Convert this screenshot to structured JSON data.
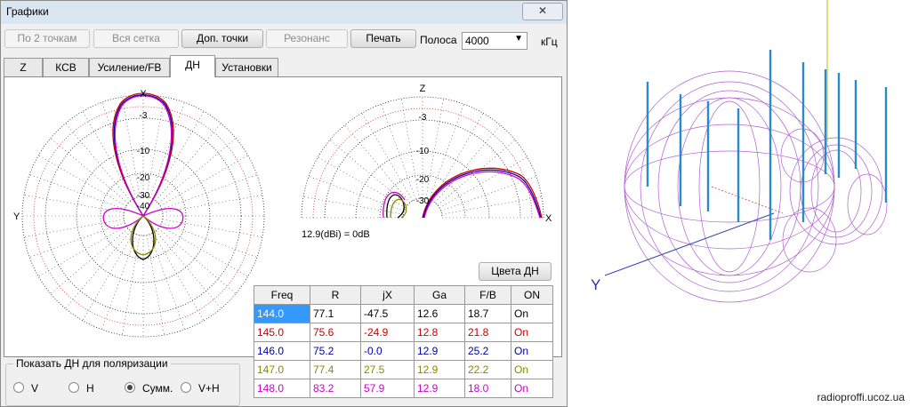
{
  "window": {
    "title": "Графики",
    "close_label": "✕"
  },
  "toolbar": {
    "btn1": "По 2 точкам",
    "btn2": "Вся сетка",
    "btn3": "Доп. точки",
    "btn4": "Резонанс",
    "btn5": "Печать",
    "band_label": "Полоса",
    "band_value": "4000",
    "band_unit": "кГц"
  },
  "tabs": [
    "Z",
    "КСВ",
    "Усиление/FB",
    "ДН",
    "Установки"
  ],
  "polar1": {
    "top": "X",
    "left": "Y",
    "rings": [
      "-3",
      "-10",
      "-20",
      "-30",
      "-40"
    ]
  },
  "polar2": {
    "top": "Z",
    "right": "X",
    "rings": [
      "-3",
      "-10",
      "-20",
      "-30"
    ],
    "note": "12.9(dBi) = 0dB"
  },
  "colors_button": "Цвета ДН",
  "table": {
    "headers": [
      "Freq",
      "R",
      "jX",
      "Ga",
      "F/B",
      "ON"
    ],
    "rows": [
      {
        "freq": "144.0",
        "r": "77.1",
        "jx": "-47.5",
        "ga": "12.6",
        "fb": "18.7",
        "on": "On",
        "color": "#000000"
      },
      {
        "freq": "145.0",
        "r": "75.6",
        "jx": "-24.9",
        "ga": "12.8",
        "fb": "21.8",
        "on": "On",
        "color": "#cc0000"
      },
      {
        "freq": "146.0",
        "r": "75.2",
        "jx": "-0.0",
        "ga": "12.9",
        "fb": "25.2",
        "on": "On",
        "color": "#0000aa"
      },
      {
        "freq": "147.0",
        "r": "77.4",
        "jx": "27.5",
        "ga": "12.9",
        "fb": "22.2",
        "on": "On",
        "color": "#888800"
      },
      {
        "freq": "148.0",
        "r": "83.2",
        "jx": "57.9",
        "ga": "12.9",
        "fb": "18.0",
        "on": "On",
        "color": "#cc00cc"
      }
    ]
  },
  "polarization": {
    "title": "Показать ДН для поляризации",
    "options": [
      "V",
      "H",
      "Сумм.",
      "V+H"
    ],
    "selected": "Сумм."
  },
  "view3d": {
    "axis_label": "Y",
    "watermark": "radioproffi.ucoz.ua"
  }
}
